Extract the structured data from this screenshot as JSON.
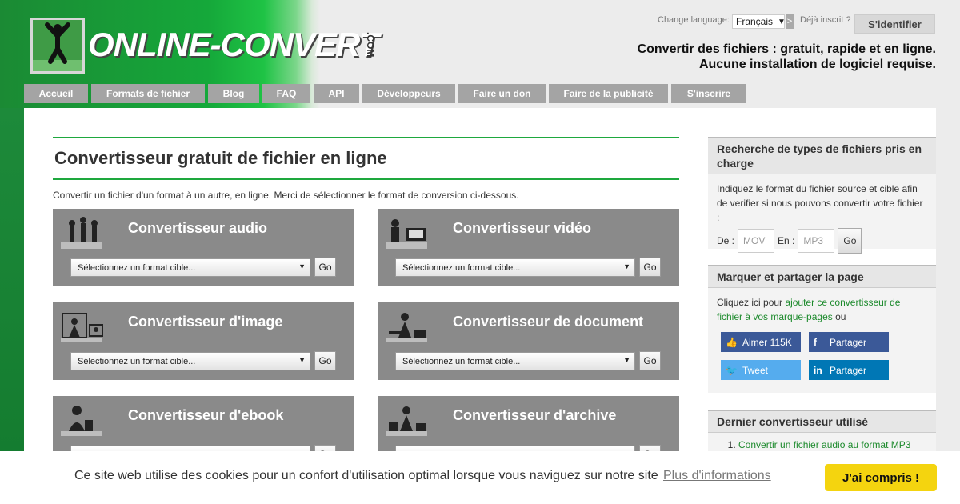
{
  "header": {
    "logo_text": "ONLINE-CONVERT",
    "logo_suffix": ".COM",
    "lang_label": "Change language:",
    "lang_value": "Français",
    "lang_next": ">",
    "already_label": "Déjà inscrit ?",
    "login_label": "S'identifier",
    "tagline_line1": "Convertir des fichiers : gratuit, rapide et en ligne.",
    "tagline_line2": "Aucune installation de logiciel requise."
  },
  "nav": [
    {
      "label": "Accueil"
    },
    {
      "label": "Formats de fichier"
    },
    {
      "label": "Blog"
    },
    {
      "label": "FAQ"
    },
    {
      "label": "API"
    },
    {
      "label": "Développeurs"
    },
    {
      "label": "Faire un don"
    },
    {
      "label": "Faire de la publicité"
    },
    {
      "label": "S'inscrire"
    }
  ],
  "main": {
    "title": "Convertisseur gratuit de fichier en ligne",
    "intro": "Convertir un fichier d'un format à un autre, en ligne. Merci de sélectionner le format de conversion ci-dessous.",
    "select_placeholder": "Sélectionnez un format cible...",
    "go_label": "Go",
    "cards": [
      {
        "title": "Convertisseur audio"
      },
      {
        "title": "Convertisseur vidéo"
      },
      {
        "title": "Convertisseur d'image"
      },
      {
        "title": "Convertisseur de document"
      },
      {
        "title": "Convertisseur d'ebook"
      },
      {
        "title": "Convertisseur d'archive"
      }
    ]
  },
  "sidebar": {
    "search_title": "Recherche de types de fichiers pris en charge",
    "search_text": "Indiquez le format du fichier source et cible afin de verifier si nous pouvons convertir votre fichier :",
    "from_label": "De :",
    "from_placeholder": "MOV",
    "to_label": "En :",
    "to_placeholder": "MP3",
    "go_label": "Go",
    "share_title": "Marquer et partager la page",
    "share_text_pre": "Cliquez ici pour",
    "share_link": "ajouter ce convertisseur de fichier à vos marque-pages",
    "share_text_post": "ou",
    "fb_like": "Aimer 115K",
    "fb_share": "Partager",
    "tweet": "Tweet",
    "li_share": "Partager",
    "last_title": "Dernier convertisseur utilisé",
    "last_item": "Convertir un fichier audio au format MP3"
  },
  "cookie": {
    "message": "Ce site web utilise des cookies pour un confort d'utilisation optimal lorsque vous naviguez sur notre site",
    "more": "Plus d'informations",
    "accept": "J'ai compris !"
  },
  "colors": {
    "brand_green": "#1ea83e",
    "nav_grey": "#a4a4a4",
    "card_grey": "#8a8a8a",
    "cookie_button": "#f4d40f",
    "facebook": "#3b5998",
    "twitter": "#55acee",
    "linkedin": "#0077b5"
  }
}
